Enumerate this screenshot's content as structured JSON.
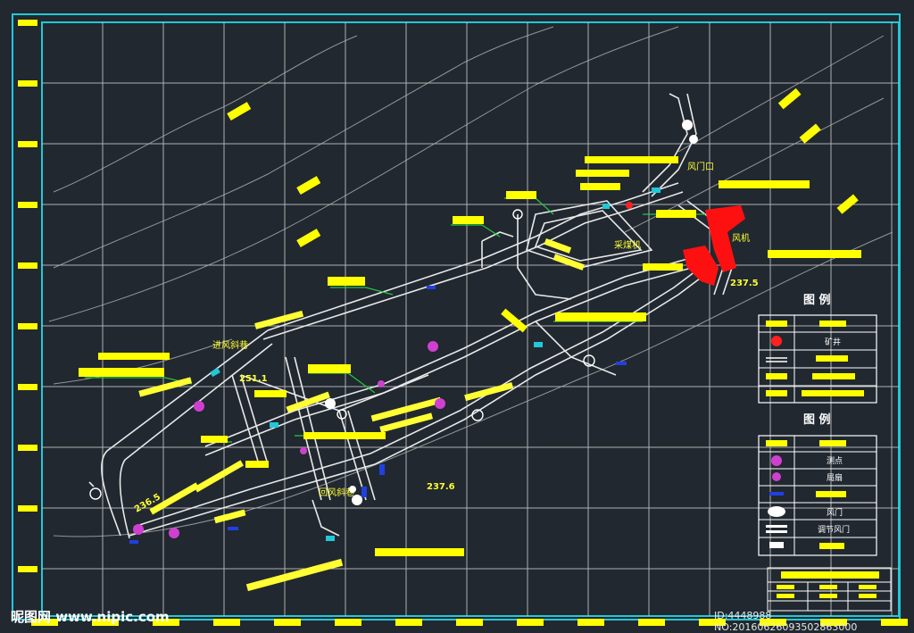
{
  "diagram": {
    "description_none": "",
    "elevations": [
      "251.1",
      "237.5",
      "237.6",
      "236.5"
    ],
    "labels": {
      "intake_shaft": "进风斜巷",
      "return_shaft": "回风斜巷",
      "door_label": "风门",
      "main_label": "采煤机",
      "vent_door": "风门口",
      "fan_label": "风机"
    },
    "legend_top": {
      "title": "图 例",
      "rows": [
        "",
        "矿井",
        "",
        ""
      ]
    },
    "legend_bottom": {
      "title": "图 例",
      "rows": [
        "",
        "测点",
        "局扇",
        "",
        "风门",
        "调节风门",
        ""
      ]
    }
  },
  "watermark": {
    "left": "昵图网 www.nipic.com",
    "right": "ID:4448988 NO:20160626093502863000"
  },
  "colors": {
    "background": "#212830",
    "grid": "#c8c8c8",
    "border": "#22c8d8",
    "yellow": "#ffff00",
    "red": "#ff1010",
    "green": "#22c840",
    "magenta": "#d040d0",
    "tunnel": "#e8e8e8"
  }
}
